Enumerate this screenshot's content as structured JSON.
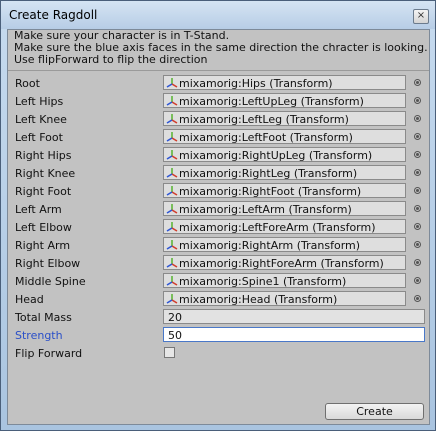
{
  "window": {
    "title": "Create Ragdoll",
    "close_glyph": "×"
  },
  "help": {
    "lines": [
      "Make sure your character is in T-Stand.",
      "Make sure the blue axis faces in the same direction the chracter is looking.",
      "Use flipForward to flip the direction"
    ]
  },
  "bones": [
    {
      "label": "Root",
      "value": "mixamorig:Hips (Transform)"
    },
    {
      "label": "Left Hips",
      "value": "mixamorig:LeftUpLeg (Transform)"
    },
    {
      "label": "Left Knee",
      "value": "mixamorig:LeftLeg (Transform)"
    },
    {
      "label": "Left Foot",
      "value": "mixamorig:LeftFoot (Transform)"
    },
    {
      "label": "Right Hips",
      "value": "mixamorig:RightUpLeg (Transform)"
    },
    {
      "label": "Right Knee",
      "value": "mixamorig:RightLeg (Transform)"
    },
    {
      "label": "Right Foot",
      "value": "mixamorig:RightFoot (Transform)"
    },
    {
      "label": "Left Arm",
      "value": "mixamorig:LeftArm (Transform)"
    },
    {
      "label": "Left Elbow",
      "value": "mixamorig:LeftForeArm (Transform)"
    },
    {
      "label": "Right Arm",
      "value": "mixamorig:RightArm (Transform)"
    },
    {
      "label": "Right Elbow",
      "value": "mixamorig:RightForeArm (Transform)"
    },
    {
      "label": "Middle Spine",
      "value": "mixamorig:Spine1 (Transform)"
    },
    {
      "label": "Head",
      "value": "mixamorig:Head (Transform)"
    }
  ],
  "total_mass": {
    "label": "Total Mass",
    "value": "20"
  },
  "strength": {
    "label": "Strength",
    "value": "50"
  },
  "flip_forward": {
    "label": "Flip Forward",
    "checked": false
  },
  "create_button": {
    "label": "Create"
  },
  "icons": {
    "transform": "transform-axes-icon",
    "picker": "object-picker-icon"
  },
  "colors": {
    "focused_label": "#2a4fc8",
    "axis_x": "#d23c2c",
    "axis_y": "#5fb53a",
    "axis_z": "#2e56d4"
  }
}
